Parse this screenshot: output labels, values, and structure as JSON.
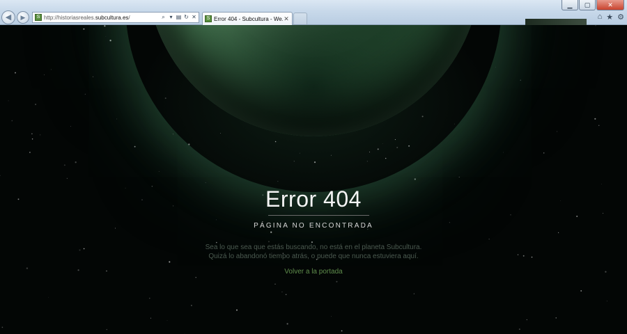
{
  "browser": {
    "url_prefix": "http://historiasreales.",
    "url_host": "subcultura.es",
    "url_suffix": "/",
    "tab_title": "Error 404 - Subcultura - We...",
    "favicon_letter": "S",
    "icons": {
      "back": "back-arrow-icon",
      "forward": "forward-arrow-icon",
      "search": "search-icon",
      "compat": "compatibility-icon",
      "refresh": "refresh-icon",
      "stop": "stop-icon",
      "home": "home-icon",
      "favorites": "star-icon",
      "tools": "gear-icon"
    }
  },
  "page": {
    "title": "Error 404",
    "subtitle": "PÁGINA NO ENCONTRADA",
    "message_line1": "Sea lo que sea que estás buscando, no está en el planeta Subcultura.",
    "message_line2": "Quizá lo abandonó tiempo atrás, o puede que nunca estuviera aquí.",
    "home_link": "Volver a la portada"
  },
  "colors": {
    "background": "#030605",
    "title": "#f4f4f4",
    "subtitle": "#d8d8d8",
    "message": "#4b5a50",
    "link": "#5f8d4c",
    "planet": "#3f6d4a"
  }
}
